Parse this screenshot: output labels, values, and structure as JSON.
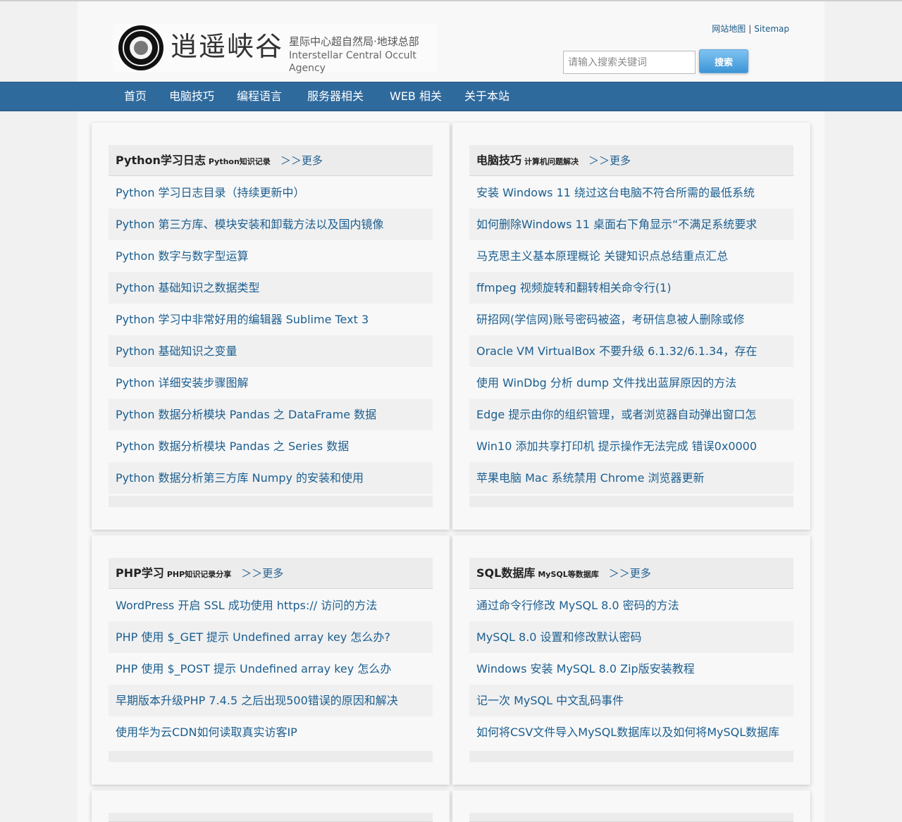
{
  "header": {
    "logo_title": "逍遥峡谷",
    "logo_subtitle_cn": "星际中心超自然局·地球总部",
    "logo_subtitle_en": "Interstellar Central Occult Agency",
    "sitemap_cn": "网站地图",
    "separator": "|",
    "sitemap_en": "Sitemap",
    "search_placeholder": "请输入搜索关键词",
    "search_button": "搜索"
  },
  "nav": {
    "items": [
      "首页",
      "电脑技巧",
      "编程语言",
      "服务器相关",
      "WEB 相关",
      "关于本站"
    ]
  },
  "sections": [
    {
      "title": "Python学习日志",
      "subtitle": "Python知识记录",
      "more": "＞＞更多",
      "items": [
        "Python 学习日志目录（持续更新中）",
        "Python 第三方库、模块安装和卸载方法以及国内镜像",
        "Python 数字与数字型运算",
        "Python 基础知识之数据类型",
        "Python 学习中非常好用的编辑器 Sublime Text 3",
        "Python 基础知识之变量",
        "Python 详细安装步骤图解",
        "Python 数据分析模块 Pandas 之 DataFrame 数据",
        "Python 数据分析模块 Pandas 之 Series 数据",
        "Python 数据分析第三方库 Numpy 的安装和使用"
      ]
    },
    {
      "title": "电脑技巧",
      "subtitle": "计算机问题解决",
      "more": "＞＞更多",
      "items": [
        "安装 Windows 11 绕过这台电脑不符合所需的最低系统",
        "如何删除Windows 11 桌面右下角显示“不满足系统要求",
        "马克思主义基本原理概论 关键知识点总结重点汇总",
        "ffmpeg 视频旋转和翻转相关命令行(1)",
        "研招网(学信网)账号密码被盗，考研信息被人删除或修",
        "Oracle VM VirtualBox 不要升级 6.1.32/6.1.34，存在",
        "使用 WinDbg 分析 dump 文件找出蓝屏原因的方法",
        "Edge 提示由你的组织管理，或者浏览器自动弹出窗口怎",
        "Win10 添加共享打印机 提示操作无法完成 错误0x0000",
        "苹果电脑 Mac 系统禁用 Chrome 浏览器更新"
      ]
    },
    {
      "title": "PHP学习",
      "subtitle": "PHP知识记录分享",
      "more": "＞＞更多",
      "items": [
        "WordPress 开启 SSL 成功使用 https:// 访问的方法",
        "PHP 使用 $_GET 提示 Undefined array key 怎么办?",
        "PHP 使用 $_POST 提示 Undefined array key 怎么办",
        "早期版本升级PHP 7.4.5 之后出现500错误的原因和解决",
        "使用华为云CDN如何读取真实访客IP"
      ]
    },
    {
      "title": "SQL数据库",
      "subtitle": "MySQL等数据库",
      "more": "＞＞更多",
      "items": [
        "通过命令行修改 MySQL 8.0 密码的方法",
        "MySQL 8.0 设置和修改默认密码",
        "Windows 安装 MySQL 8.0 Zip版安装教程",
        "记一次 MySQL 中文乱码事件",
        "如何将CSV文件导入MySQL数据库以及如何将MySQL数据库"
      ]
    }
  ]
}
